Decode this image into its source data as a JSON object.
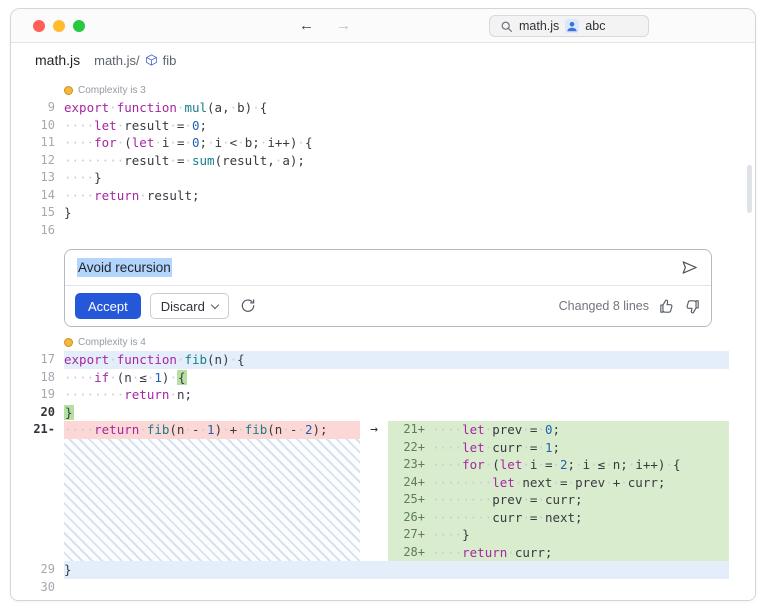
{
  "titlebar": {
    "back": "←",
    "forward": "→",
    "search": {
      "project": "math.js",
      "collab_name": "abc"
    }
  },
  "tabbar": {
    "tab_label": "math.js",
    "path": "math.js/",
    "symbol": "fib"
  },
  "annotations": {
    "top": "Complexity is 3",
    "bottom": "Complexity is 4"
  },
  "assist_panel": {
    "prompt_text": "Avoid recursion",
    "accept_label": "Accept",
    "discard_label": "Discard",
    "status_text": "Changed 8 lines"
  },
  "colors": {
    "accent_blue": "#2458d8",
    "selection": "#b3d4fc",
    "diff_added_bg": "#d9eccd",
    "diff_deleted_bg": "#fbd7d5",
    "region_bg": "#e4eefa"
  },
  "code": {
    "arrow": "→",
    "top": [
      {
        "n": "9",
        "seg": [
          [
            "export function ",
            "kw"
          ],
          [
            "mul",
            "fn"
          ],
          [
            "(a, b) {",
            "pl"
          ]
        ]
      },
      {
        "n": "10",
        "seg": [
          [
            "    ",
            "pl"
          ],
          [
            "let ",
            "kw"
          ],
          [
            "result = ",
            "pl"
          ],
          [
            "0",
            "num"
          ],
          [
            ";",
            "pl"
          ]
        ]
      },
      {
        "n": "11",
        "seg": [
          [
            "    ",
            "pl"
          ],
          [
            "for ",
            "kw"
          ],
          [
            "(",
            "pl"
          ],
          [
            "let ",
            "kw"
          ],
          [
            "i = ",
            "pl"
          ],
          [
            "0",
            "num"
          ],
          [
            "; i < b; i++) {",
            "pl"
          ]
        ]
      },
      {
        "n": "12",
        "seg": [
          [
            "        result = ",
            "pl"
          ],
          [
            "sum",
            "fn"
          ],
          [
            "(result, a);",
            "pl"
          ]
        ]
      },
      {
        "n": "13",
        "seg": [
          [
            "    }",
            "pl"
          ]
        ]
      },
      {
        "n": "14",
        "seg": [
          [
            "    ",
            "pl"
          ],
          [
            "return ",
            "kw"
          ],
          [
            "result;",
            "pl"
          ]
        ]
      },
      {
        "n": "15",
        "seg": [
          [
            "}",
            "pl"
          ]
        ]
      },
      {
        "n": "16",
        "seg": []
      }
    ],
    "mid": [
      {
        "n": "17",
        "row": "blue",
        "seg": [
          [
            "export function ",
            "kw"
          ],
          [
            "fib",
            "fn"
          ],
          [
            "(n) {",
            "pl"
          ]
        ]
      },
      {
        "n": "18",
        "seg": [
          [
            "    ",
            "pl"
          ],
          [
            "if ",
            "kw"
          ],
          [
            "(n ≤ ",
            "pl"
          ],
          [
            "1",
            "num"
          ],
          [
            ") ",
            "pl"
          ],
          [
            "{",
            "add"
          ]
        ]
      },
      {
        "n": "19",
        "seg": [
          [
            "        ",
            "pl"
          ],
          [
            "return ",
            "kw"
          ],
          [
            "n;",
            "pl"
          ]
        ]
      },
      {
        "n": "20",
        "bold": true,
        "seg": [
          [
            "}",
            "add"
          ]
        ]
      }
    ],
    "deleted": {
      "n": "21-",
      "bold": true,
      "seg": [
        [
          "    ",
          "pl"
        ],
        [
          "return ",
          "kw"
        ],
        [
          "fib",
          "fn"
        ],
        [
          "(n - ",
          "pl"
        ],
        [
          "1",
          "num"
        ],
        [
          ") + ",
          "pl"
        ],
        [
          "fib",
          "fn"
        ],
        [
          "(n - ",
          "pl"
        ],
        [
          "2",
          "num"
        ],
        [
          ");",
          "pl"
        ]
      ]
    },
    "added": [
      {
        "n": "21+",
        "seg": [
          [
            "    ",
            "pl"
          ],
          [
            "let ",
            "kw"
          ],
          [
            "prev = ",
            "pl"
          ],
          [
            "0",
            "num"
          ],
          [
            ";",
            "pl"
          ]
        ]
      },
      {
        "n": "22+",
        "seg": [
          [
            "    ",
            "pl"
          ],
          [
            "let ",
            "kw"
          ],
          [
            "curr = ",
            "pl"
          ],
          [
            "1",
            "num"
          ],
          [
            ";",
            "pl"
          ]
        ]
      },
      {
        "n": "23+",
        "seg": [
          [
            "    ",
            "pl"
          ],
          [
            "for ",
            "kw"
          ],
          [
            "(",
            "pl"
          ],
          [
            "let ",
            "kw"
          ],
          [
            "i = ",
            "pl"
          ],
          [
            "2",
            "num"
          ],
          [
            "; i ≤ n; i++) {",
            "pl"
          ]
        ]
      },
      {
        "n": "24+",
        "seg": [
          [
            "        ",
            "pl"
          ],
          [
            "let ",
            "kw"
          ],
          [
            "next = prev + curr;",
            "pl"
          ]
        ]
      },
      {
        "n": "25+",
        "seg": [
          [
            "        prev = curr;",
            "pl"
          ]
        ]
      },
      {
        "n": "26+",
        "seg": [
          [
            "        curr = next;",
            "pl"
          ]
        ]
      },
      {
        "n": "27+",
        "seg": [
          [
            "    }",
            "pl"
          ]
        ]
      },
      {
        "n": "28+",
        "seg": [
          [
            "    ",
            "pl"
          ],
          [
            "return ",
            "kw"
          ],
          [
            "curr;",
            "pl"
          ]
        ]
      }
    ],
    "tail": [
      {
        "n": "29",
        "row": "blue",
        "seg": [
          [
            "}",
            "pl"
          ]
        ]
      },
      {
        "n": "30",
        "seg": []
      }
    ]
  }
}
